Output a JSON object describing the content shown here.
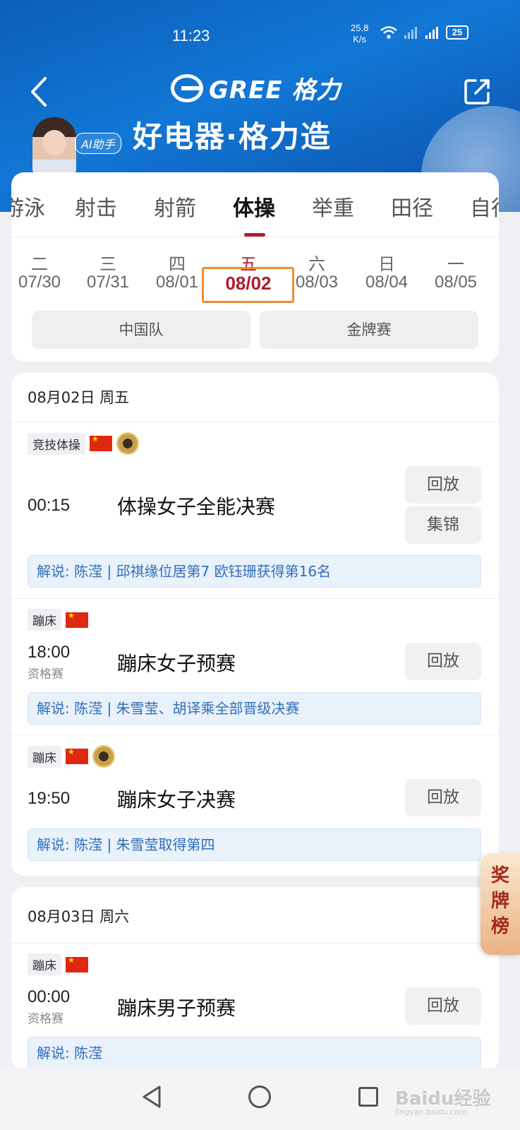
{
  "status": {
    "time": "11:23",
    "speed": "25.8",
    "speed_unit": "K/s",
    "battery": "25"
  },
  "header": {
    "brand": "GREE 格力",
    "slogan": "好电器·格力造",
    "ai_badge": "AI助手"
  },
  "tabs": [
    "游泳",
    "射击",
    "射箭",
    "体操",
    "举重",
    "田径",
    "自行"
  ],
  "active_tab": "体操",
  "dates": [
    {
      "dow": "二",
      "date": "07/30"
    },
    {
      "dow": "三",
      "date": "07/31"
    },
    {
      "dow": "四",
      "date": "08/01"
    },
    {
      "dow": "五",
      "date": "08/02"
    },
    {
      "dow": "六",
      "date": "08/03"
    },
    {
      "dow": "日",
      "date": "08/04"
    },
    {
      "dow": "一",
      "date": "08/05"
    }
  ],
  "filters": {
    "team": "中国队",
    "gold": "金牌赛"
  },
  "days": [
    {
      "header": "08月02日 周五",
      "events": [
        {
          "tag": "竞技体操",
          "time": "00:15",
          "sub": "",
          "title": "体操女子全能决赛",
          "buttons": [
            "回放",
            "集锦"
          ],
          "commentary": "解说: 陈滢 | 邱祺缘位居第7 欧钰珊获得第16名"
        },
        {
          "tag": "蹦床",
          "time": "18:00",
          "sub": "资格赛",
          "title": "蹦床女子预赛",
          "buttons": [
            "回放"
          ],
          "commentary": "解说: 陈滢 | 朱雪莹、胡译乘全部晋级决赛"
        },
        {
          "tag": "蹦床",
          "time": "19:50",
          "sub": "",
          "title": "蹦床女子决赛",
          "buttons": [
            "回放"
          ],
          "commentary": "解说: 陈滢 | 朱雪莹取得第四"
        }
      ]
    },
    {
      "header": "08月03日 周六",
      "events": [
        {
          "tag": "蹦床",
          "time": "00:00",
          "sub": "资格赛",
          "title": "蹦床男子预赛",
          "buttons": [
            "回放"
          ],
          "commentary": "解说: 陈滢"
        }
      ]
    }
  ],
  "medal_tab": "奖牌榜",
  "watermark": {
    "main": "Baidu经验",
    "sub": "jingyan.baidu.com"
  },
  "colors": {
    "accent": "#b01b2e",
    "highlight_box": "#f08c34",
    "commentary_text": "#2f6fba"
  }
}
